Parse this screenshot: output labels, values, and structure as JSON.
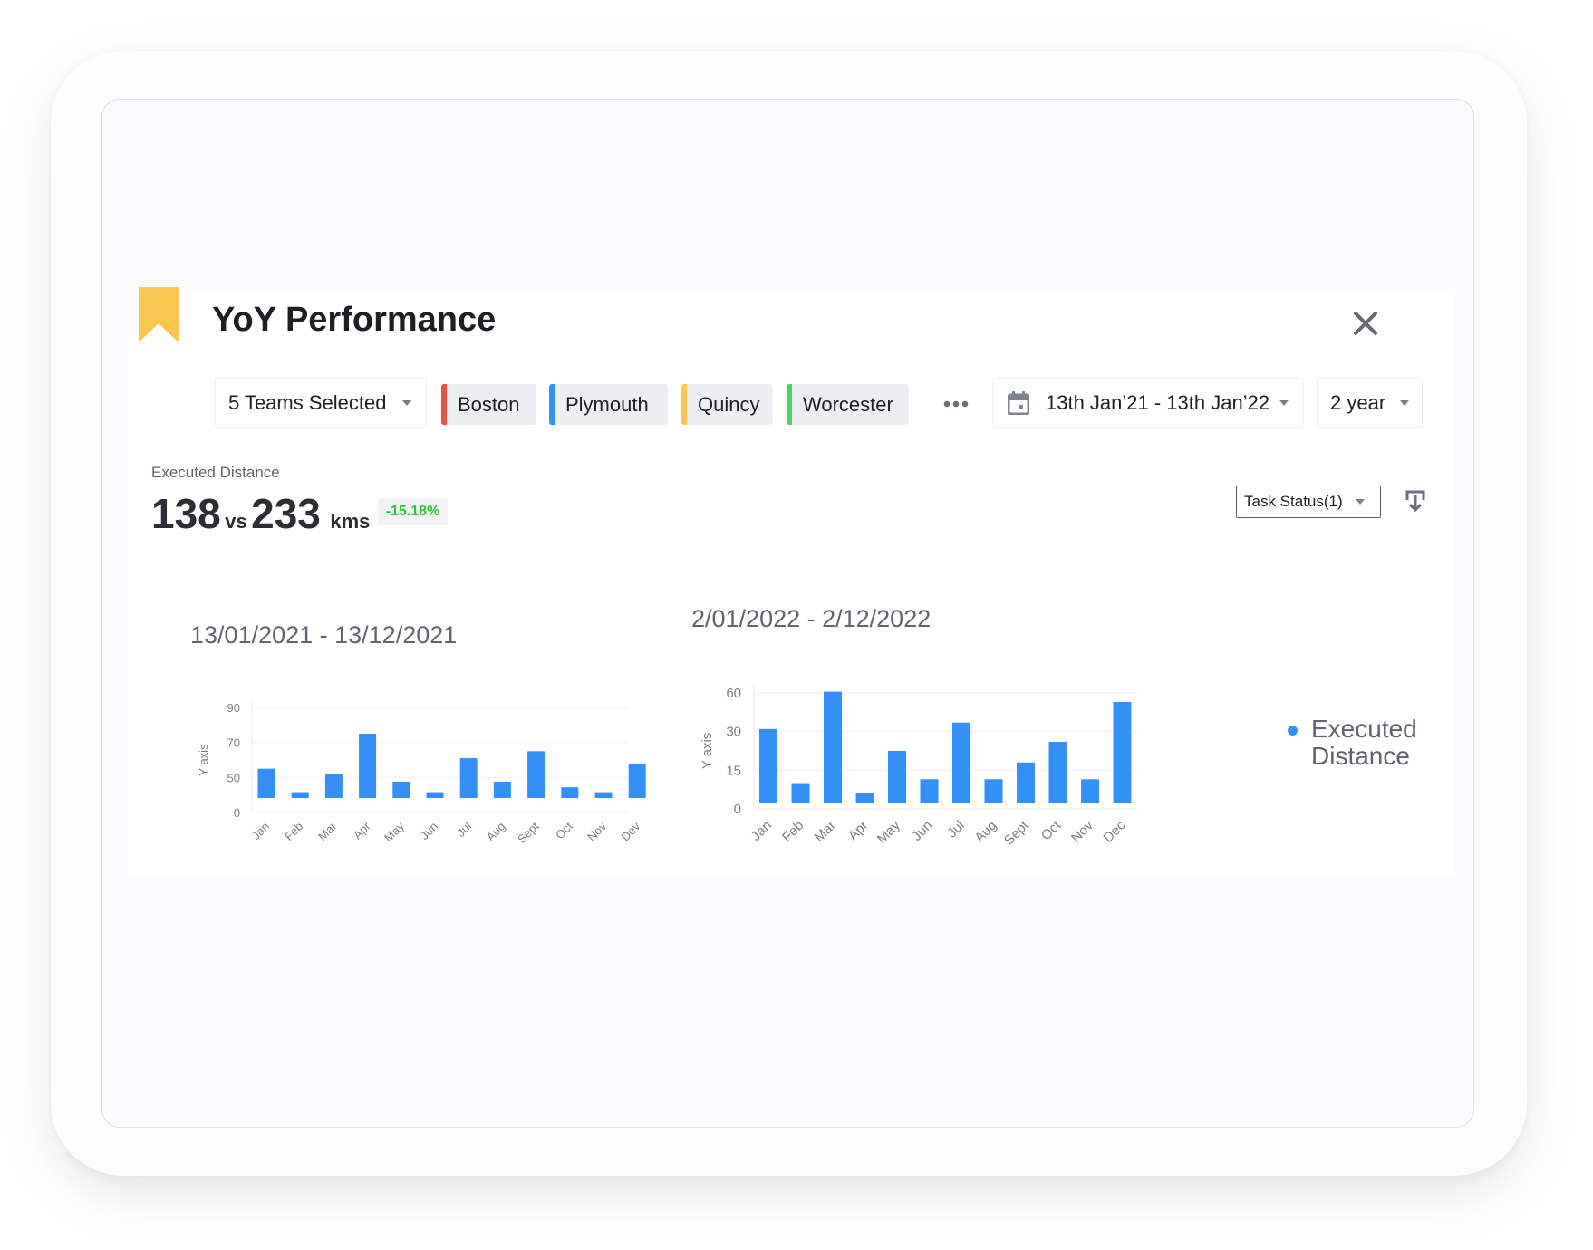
{
  "header": {
    "title": "YoY Performance"
  },
  "filters": {
    "teams_select": "5 Teams Selected",
    "teams": [
      {
        "label": "Boston",
        "color": "#e8534a"
      },
      {
        "label": "Plymouth",
        "color": "#3390f7"
      },
      {
        "label": "Quincy",
        "color": "#f9c74f"
      },
      {
        "label": "Worcester",
        "color": "#4cd45a"
      }
    ],
    "more_icon": "ellipsis-icon",
    "date_range": "13th Jan’21 - 13th Jan’22",
    "period": "2 year"
  },
  "metric": {
    "label": "Executed Distance",
    "current": "138",
    "vs": "vs",
    "previous": "233",
    "unit": "kms",
    "change": "-15.18%",
    "change_color": "#2fc53b"
  },
  "task_status": "Task Status(1)",
  "accent_color": "#3390f7",
  "legend": {
    "line1": "Executed",
    "line2": "Distance"
  },
  "chart_data": [
    {
      "type": "bar",
      "title": "13/01/2021 - 13/12/2021",
      "ylabel": "Y axis",
      "xlabel": "",
      "categories": [
        "Jan",
        "Feb",
        "Mar",
        "Apr",
        "May",
        "Jun",
        "Jul",
        "Aug",
        "Sept",
        "Oct",
        "Nov",
        "Dev"
      ],
      "values": [
        55,
        29,
        52,
        75,
        44,
        29,
        61,
        44,
        65,
        36,
        29,
        58
      ],
      "yticks": [
        0,
        50,
        70,
        90
      ],
      "ylim": [
        0,
        90
      ],
      "grid": true
    },
    {
      "type": "bar",
      "title": "2/01/2022 - 2/12/2022",
      "ylabel": "Y axis",
      "xlabel": "",
      "categories": [
        "Jan",
        "Feb",
        "Mar",
        "Apr",
        "May",
        "Jun",
        "Jul",
        "Aug",
        "Sept",
        "Oct",
        "Nov",
        "Dec"
      ],
      "values": [
        32,
        10,
        61,
        6,
        22.5,
        11.5,
        37,
        11.5,
        18,
        26,
        11.5,
        53
      ],
      "yticks": [
        0,
        15,
        30,
        60
      ],
      "ylim": [
        0,
        60
      ],
      "grid": true,
      "legend": [
        "Executed Distance"
      ],
      "legend_position": "right"
    }
  ]
}
